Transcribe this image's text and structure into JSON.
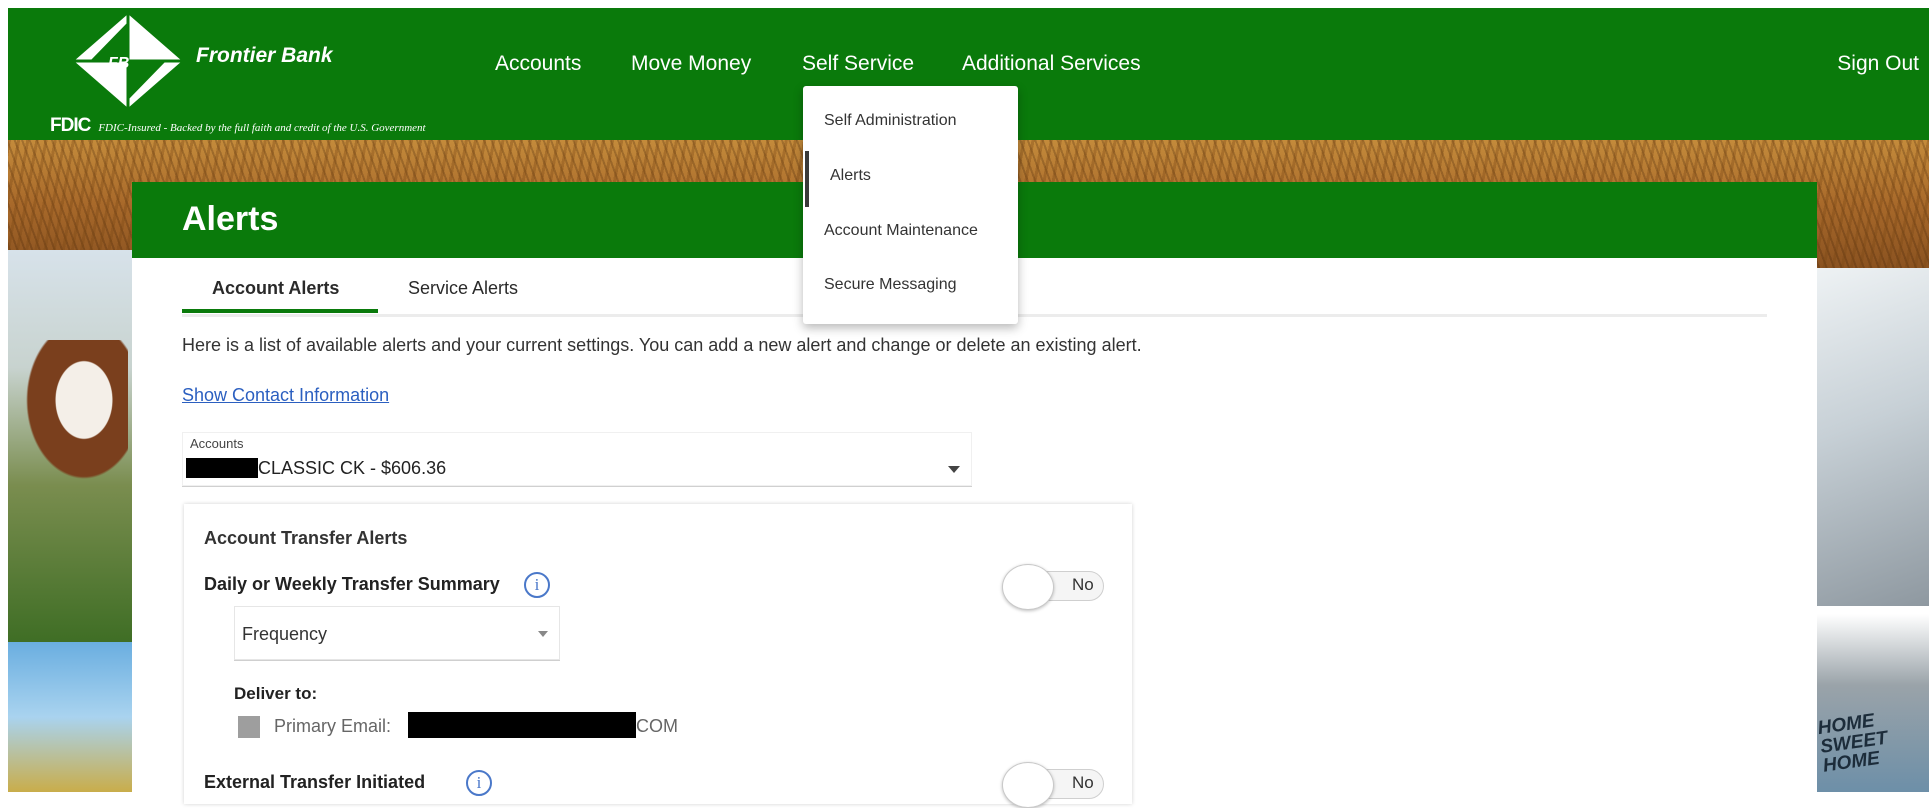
{
  "header": {
    "bank_name": "Frontier Bank",
    "logo_initials": "FB",
    "fdic_mark": "FDIC",
    "fdic_text": "FDIC-Insured - Backed by the full faith and credit of the U.S. Government",
    "nav": [
      {
        "label": "Accounts"
      },
      {
        "label": "Move Money"
      },
      {
        "label": "Self Service"
      },
      {
        "label": "Additional Services"
      }
    ],
    "sign_out": "Sign Out"
  },
  "self_service_menu": {
    "items": [
      {
        "label": "Self Administration"
      },
      {
        "label": "Alerts"
      },
      {
        "label": "Account Maintenance"
      },
      {
        "label": "Secure Messaging"
      }
    ],
    "active_index": 1
  },
  "page": {
    "title": "Alerts",
    "tabs": [
      {
        "label": "Account Alerts",
        "active": true
      },
      {
        "label": "Service Alerts",
        "active": false
      }
    ],
    "intro": "Here is a list of available alerts and your current settings. You can add a new alert and change or delete an existing alert.",
    "contact_link": "Show Contact Information",
    "account_select": {
      "label": "Accounts",
      "value": "CLASSIC CK -  $606.36"
    },
    "panel": {
      "section_title": "Account Transfer Alerts",
      "alerts": [
        {
          "name": "Daily or Weekly Transfer Summary",
          "toggle": "No"
        },
        {
          "name": "External Transfer Initiated",
          "toggle": "No"
        }
      ],
      "frequency_placeholder": "Frequency",
      "deliver_to": "Deliver to:",
      "primary_email_label": "Primary Email:",
      "primary_email_suffix": "COM"
    }
  },
  "side_image_text": {
    "home_tag": "HOME SWEET HOME"
  },
  "colors": {
    "brand_green": "#0a7a0b",
    "link_blue": "#2b5fc0",
    "info_blue": "#4a78c9"
  },
  "icons": {
    "info": "info-icon",
    "caret": "chevron-down-icon"
  }
}
